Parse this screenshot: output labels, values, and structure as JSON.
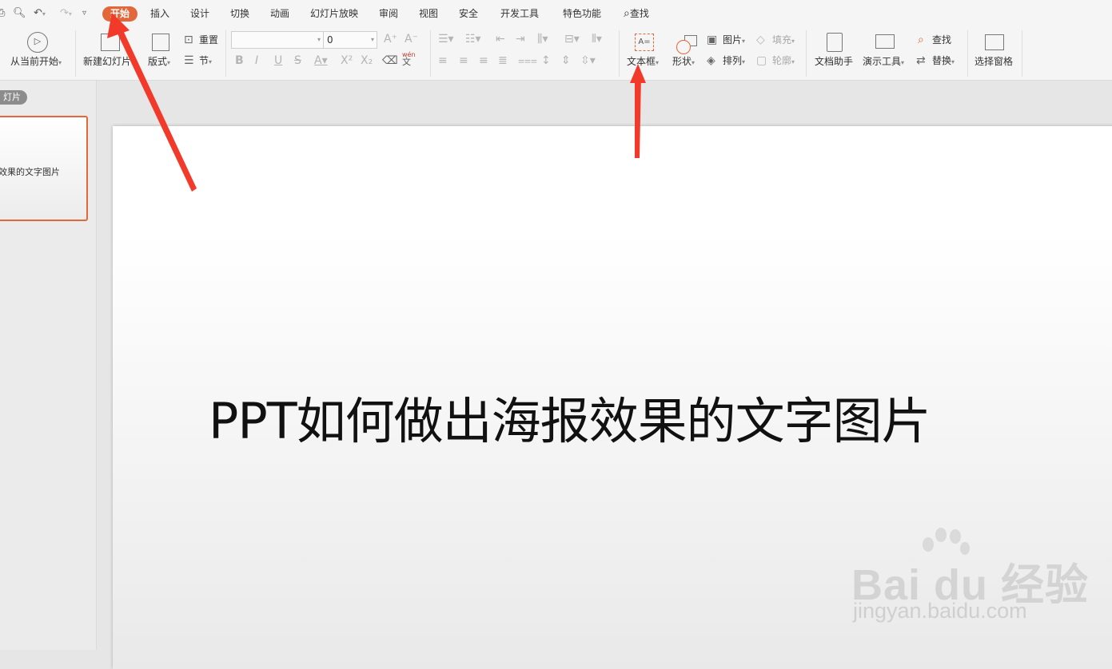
{
  "quick_access": {
    "icons": [
      "print-icon",
      "print-preview-icon",
      "undo-icon",
      "redo-icon",
      "customize-icon"
    ]
  },
  "menu": {
    "tabs": [
      "开始",
      "插入",
      "设计",
      "切换",
      "动画",
      "幻灯片放映",
      "审阅",
      "视图",
      "安全",
      "开发工具",
      "特色功能"
    ],
    "active_tab": "开始",
    "search_label": "查找"
  },
  "ribbon": {
    "play_from_current": "从当前开始",
    "new_slide": "新建幻灯片",
    "layout": "版式",
    "reset": "重置",
    "section": "节",
    "font_name": "",
    "font_size": "0",
    "text_box": "文本框",
    "shapes": "形状",
    "picture": "图片",
    "fill": "填充",
    "arrange": "排列",
    "outline": "轮廓",
    "doc_assistant": "文档助手",
    "presentation_tools": "演示工具",
    "find": "查找",
    "replace": "替换",
    "selection_pane": "选择窗格",
    "phonetic_top": "wén",
    "phonetic_bottom": "文"
  },
  "left_panel": {
    "tab_label": "灯片",
    "thumbnail_text": "效果的文字图片"
  },
  "slide": {
    "title": "PPT如何做出海报效果的文字图片"
  },
  "watermark": {
    "brand": "Bai du 经验",
    "url": "jingyan.baidu.com"
  },
  "colors": {
    "accent": "#e2673a",
    "annotation_arrow": "#f23a2a"
  }
}
